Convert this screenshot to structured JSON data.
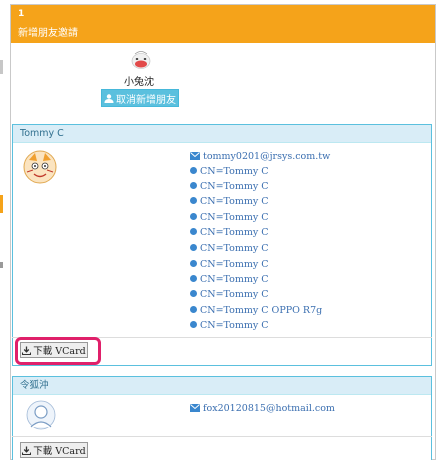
{
  "header": {
    "count": "1",
    "title": "新增朋友邀請"
  },
  "invite": {
    "name": "小兔沈",
    "cancel_label": "取消新增朋友"
  },
  "contacts": [
    {
      "name": "Tommy C",
      "email": "tommy0201@jrsys.com.tw",
      "certificates": [
        "CN=Tommy C",
        "CN=Tommy C",
        "CN=Tommy C",
        "CN=Tommy C",
        "CN=Tommy C",
        "CN=Tommy C",
        "CN=Tommy C",
        "CN=Tommy C",
        "CN=Tommy C",
        "CN=Tommy C OPPO R7g",
        "CN=Tommy C"
      ],
      "vcard_label": "下載 VCard"
    },
    {
      "name": "令狐沖",
      "email": "fox20120815@hotmail.com",
      "vcard_label": "下載 VCard"
    }
  ],
  "colors": {
    "header": "#f5a31a",
    "info_button": "#5bc0de",
    "link": "#3b6fb0",
    "highlight": "#e0206a"
  }
}
